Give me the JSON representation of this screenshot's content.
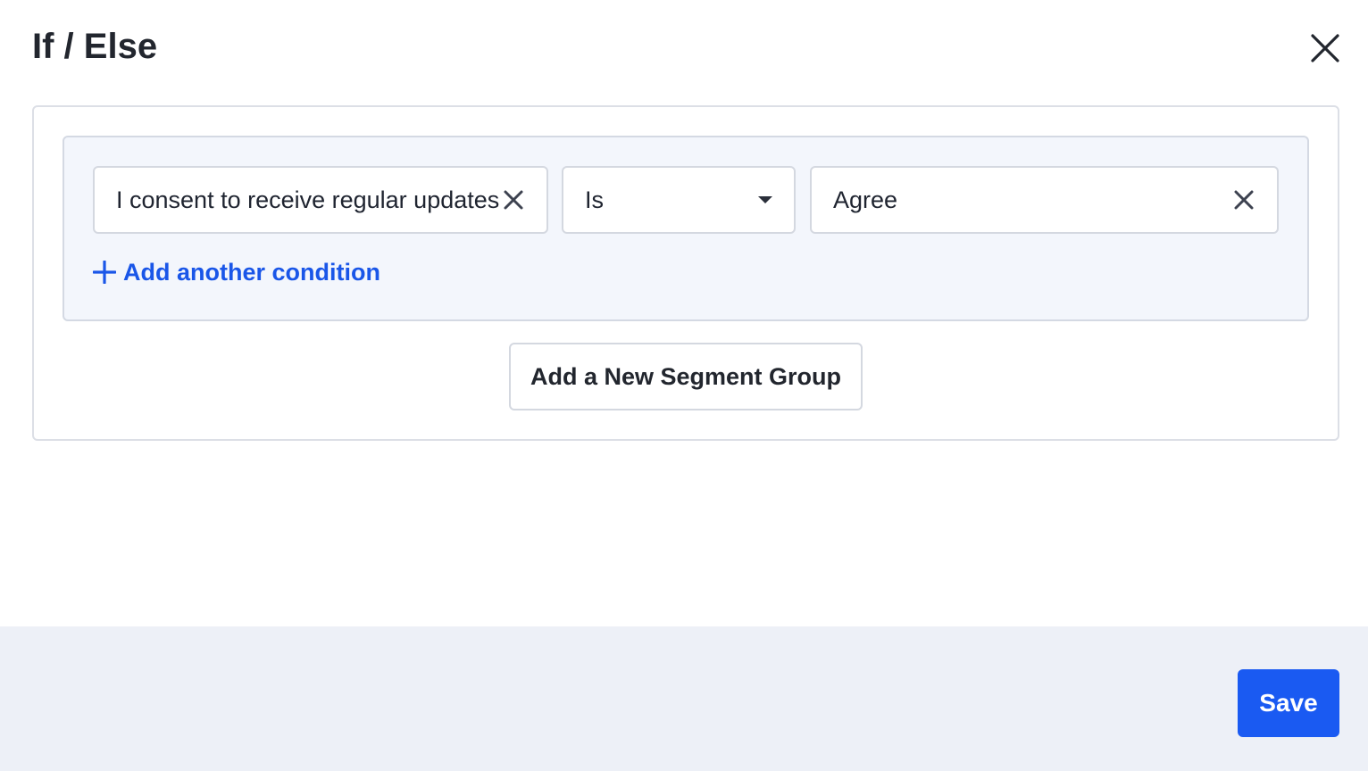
{
  "modal": {
    "title": "If / Else",
    "close_icon": "close-icon"
  },
  "segment_group": {
    "condition": {
      "field_value": "I consent to receive regular updates",
      "clear_icon": "clear-icon"
    },
    "operator": {
      "selected": "Is",
      "caret_icon": "caret-down-icon"
    },
    "value": {
      "selected": "Agree",
      "clear_icon": "clear-icon"
    },
    "add_condition_label": "Add another condition",
    "add_condition_icon": "plus-icon"
  },
  "add_segment_group_label": "Add a New Segment Group",
  "footer": {
    "save_label": "Save"
  },
  "colors": {
    "accent": "#1a5af2",
    "link": "#1a56e8",
    "group_bg": "#f3f6fc",
    "footer_bg": "#edf0f7"
  }
}
